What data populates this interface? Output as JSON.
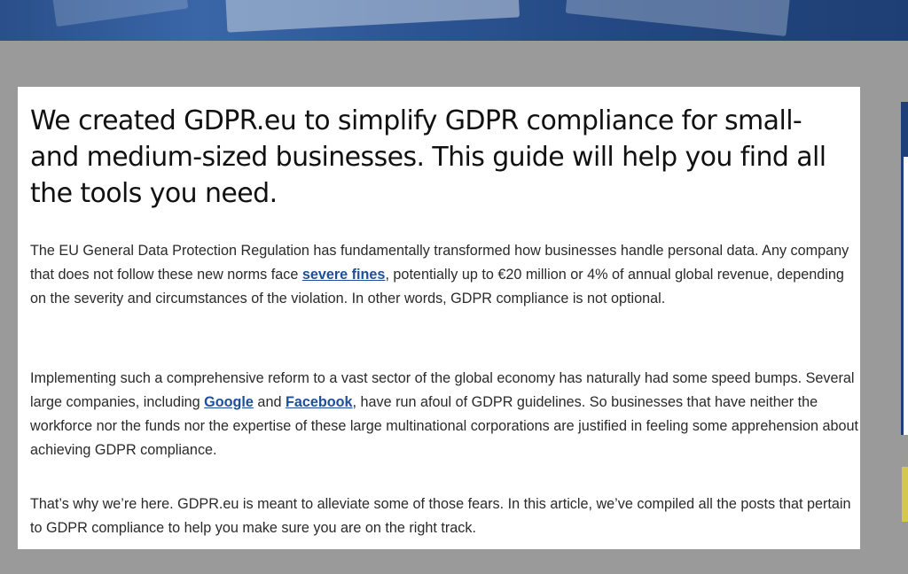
{
  "article": {
    "headline": "We created GDPR.eu to simplify GDPR compliance for small- and medium-sized businesses. This guide will help you find all the tools you need.",
    "paragraph1": {
      "before_link": "The EU General Data Protection Regulation has fundamentally transformed how businesses handle personal data. Any company that does not follow these new norms face ",
      "link": "severe fines",
      "after_link": ", potentially up to €20 million or 4% of annual global revenue, depending on the severity and circumstances of the violation. In other words, GDPR compliance is not optional."
    },
    "paragraph2": {
      "text_a": "Implementing such a comprehensive reform to a vast sector of the global economy has naturally had some speed bumps. Several large companies, including ",
      "link_google": "Google",
      "text_b": " and ",
      "link_facebook": "Facebook",
      "text_c": ", have run afoul of GDPR guidelines. So businesses that have neither the workforce nor the funds nor the expertise of these large multinational corporations are justified in feeling some apprehension about achieving GDPR compliance."
    },
    "paragraph3": "That’s why we’re here. GDPR.eu is meant to alleviate some of those fears. In this article, we’ve compiled all the posts that pertain to GDPR compliance to help you make sure you are on the right track."
  },
  "colors": {
    "link": "#1f4e9a",
    "page_background": "#9a9a9a",
    "hero_blue": "#2a4f8a",
    "side_accent": "#d4c84a"
  }
}
